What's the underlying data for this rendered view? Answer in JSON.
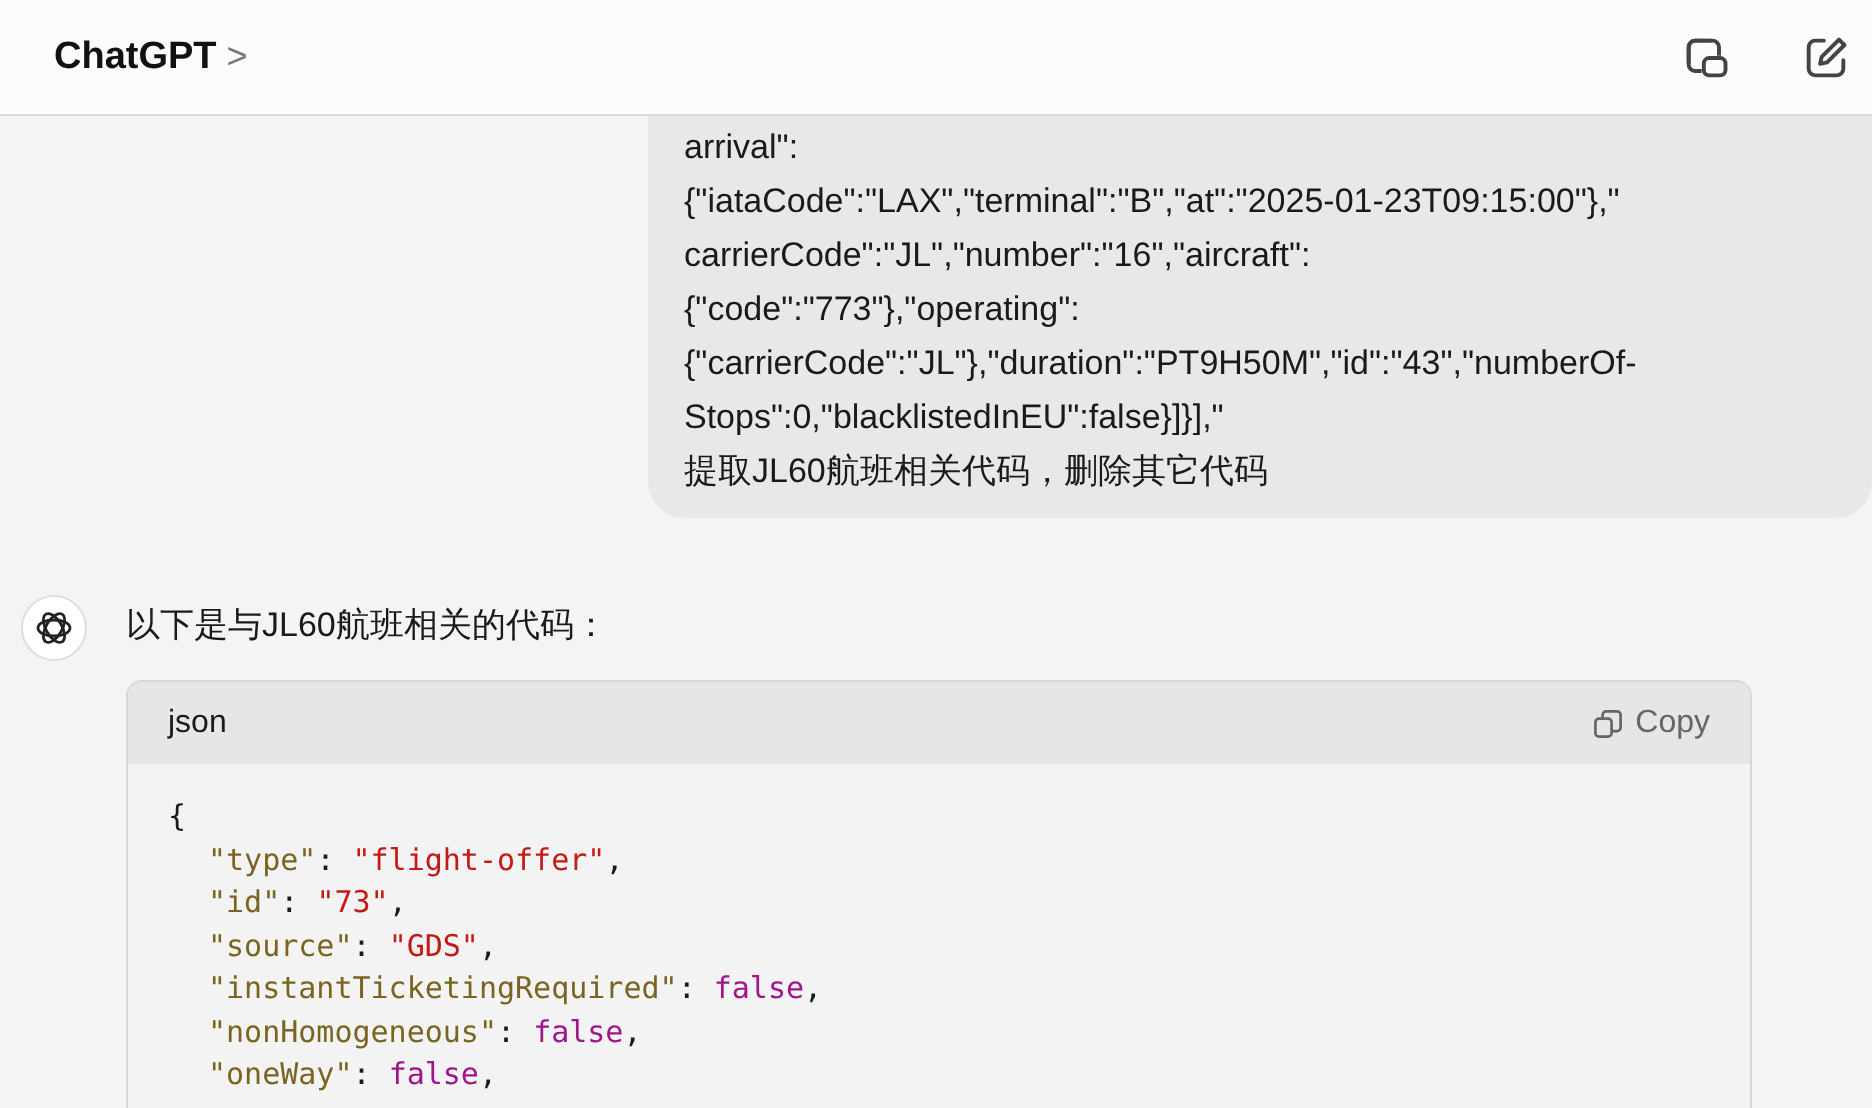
{
  "header": {
    "title": "ChatGPT",
    "chevron": ">"
  },
  "user_message": {
    "lines": [
      "arrival\":",
      "{\"iataCode\":\"LAX\",\"terminal\":\"B\",\"at\":\"2025-01-23T09:15:00\"},\"",
      "carrierCode\":\"JL\",\"number\":\"16\",\"aircraft\":",
      "{\"code\":\"773\"},\"operating\":",
      "{\"carrierCode\":\"JL\"},\"duration\":\"PT9H50M\",\"id\":\"43\",\"numberOf-",
      "Stops\":0,\"blacklistedInEU\":false}]}],\"",
      "提取JL60航班相关代码，删除其它代码"
    ]
  },
  "assistant_message": {
    "text": "以下是与JL60航班相关的代码：",
    "code_block": {
      "language": "json",
      "copy_label": "Copy",
      "lines": [
        {
          "tokens": [
            {
              "kind": "punct",
              "text": "{"
            }
          ],
          "children": [
            {
              "tokens": [
                {
                  "kind": "key",
                  "text": "\"type\""
                },
                {
                  "kind": "punct",
                  "text": ": "
                },
                {
                  "kind": "string",
                  "text": "\"flight-offer\""
                },
                {
                  "kind": "punct",
                  "text": ","
                }
              ]
            },
            {
              "tokens": [
                {
                  "kind": "key",
                  "text": "\"id\""
                },
                {
                  "kind": "punct",
                  "text": ": "
                },
                {
                  "kind": "string",
                  "text": "\"73\""
                },
                {
                  "kind": "punct",
                  "text": ","
                }
              ]
            },
            {
              "tokens": [
                {
                  "kind": "key",
                  "text": "\"source\""
                },
                {
                  "kind": "punct",
                  "text": ": "
                },
                {
                  "kind": "string",
                  "text": "\"GDS\""
                },
                {
                  "kind": "punct",
                  "text": ","
                }
              ]
            },
            {
              "tokens": [
                {
                  "kind": "key",
                  "text": "\"instantTicketingRequired\""
                },
                {
                  "kind": "punct",
                  "text": ": "
                },
                {
                  "kind": "bool",
                  "text": "false"
                },
                {
                  "kind": "punct",
                  "text": ","
                }
              ]
            },
            {
              "tokens": [
                {
                  "kind": "key",
                  "text": "\"nonHomogeneous\""
                },
                {
                  "kind": "punct",
                  "text": ": "
                },
                {
                  "kind": "bool",
                  "text": "false"
                },
                {
                  "kind": "punct",
                  "text": ","
                }
              ]
            },
            {
              "tokens": [
                {
                  "kind": "key",
                  "text": "\"oneWay\""
                },
                {
                  "kind": "punct",
                  "text": ": "
                },
                {
                  "kind": "bool",
                  "text": "false"
                },
                {
                  "kind": "punct",
                  "text": ","
                }
              ]
            }
          ]
        }
      ]
    }
  }
}
